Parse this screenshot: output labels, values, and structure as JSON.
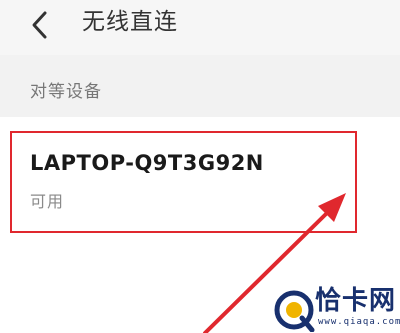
{
  "header": {
    "title": "无线直连",
    "back_icon": "chevron-left-icon"
  },
  "section": {
    "title": "对等设备"
  },
  "devices": [
    {
      "name": "LAPTOP-Q9T3G92N",
      "status": "可用"
    }
  ],
  "annotation": {
    "color": "#e0282e"
  },
  "watermark": {
    "text": "恰卡网",
    "url": "www.qiaqa.com"
  }
}
